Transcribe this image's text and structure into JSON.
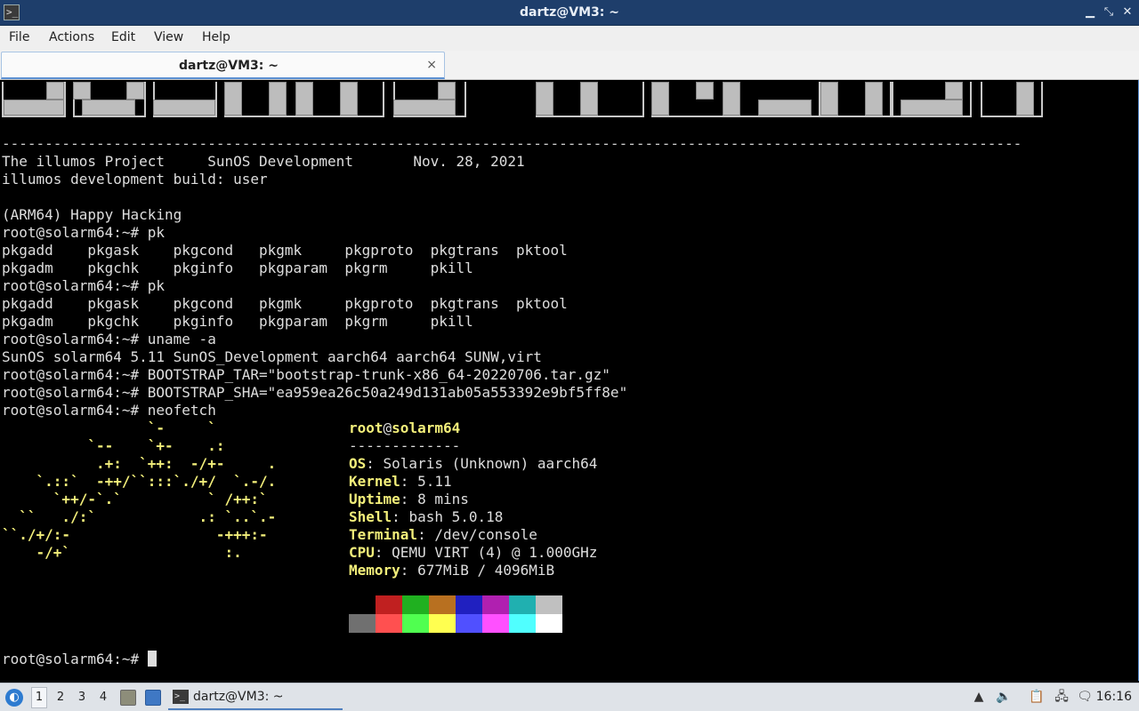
{
  "window": {
    "title": "dartz@VM3: ~"
  },
  "menu": [
    "File",
    "Actions",
    "Edit",
    "View",
    "Help"
  ],
  "tab": {
    "label": "dartz@VM3: ~",
    "close": "×"
  },
  "terminal": {
    "dash_line": "-----------------------------------------------------------------------------------------------------------------------",
    "lines": [
      "The illumos Project     SunOS Development       Nov. 28, 2021",
      "illumos development build: user",
      "",
      "(ARM64) Happy Hacking",
      "root@solarm64:~# pk",
      "pkgadd    pkgask    pkgcond   pkgmk     pkgproto  pkgtrans  pktool",
      "pkgadm    pkgchk    pkginfo   pkgparam  pkgrm     pkill",
      "root@solarm64:~# pk",
      "pkgadd    pkgask    pkgcond   pkgmk     pkgproto  pkgtrans  pktool",
      "pkgadm    pkgchk    pkginfo   pkgparam  pkgrm     pkill",
      "root@solarm64:~# uname -a",
      "SunOS solarm64 5.11 SunOS_Development aarch64 aarch64 SUNW,virt",
      "root@solarm64:~# BOOTSTRAP_TAR=\"bootstrap-trunk-x86_64-20220706.tar.gz\"",
      "root@solarm64:~# BOOTSTRAP_SHA=\"ea959ea26c50a249d131ab05a553392e9bf5ff8e\"",
      "root@solarm64:~# neofetch"
    ],
    "logo": [
      "                 `-     `",
      "          `--    `+-    .:",
      "           .+:  `++:  -/+-     .",
      "    `.::`  -++/``:::`./+/  `.-/.",
      "      `++/-`.`          ` /++:`",
      "  ``   ./:`            .: `..`.-",
      "``./+/:-                 -+++:-",
      "    -/+`                  :."
    ],
    "neofetch": {
      "user": "root",
      "at": "@",
      "host": "solarm64",
      "underline": "-------------",
      "fields": [
        {
          "key": "OS",
          "value": "Solaris (Unknown) aarch64"
        },
        {
          "key": "Kernel",
          "value": "5.11"
        },
        {
          "key": "Uptime",
          "value": "8 mins"
        },
        {
          "key": "Shell",
          "value": "bash 5.0.18"
        },
        {
          "key": "Terminal",
          "value": "/dev/console"
        },
        {
          "key": "CPU",
          "value": "QEMU VIRT (4) @ 1.000GHz"
        },
        {
          "key": "Memory",
          "value": "677MiB / 4096MiB"
        }
      ],
      "palette_top": [
        "#000000",
        "#c02020",
        "#20b020",
        "#b87020",
        "#2020c0",
        "#b020b0",
        "#20b0b0",
        "#c0c0c0"
      ],
      "palette_bottom": [
        "#707070",
        "#ff5050",
        "#50ff50",
        "#ffff50",
        "#5050ff",
        "#ff50ff",
        "#50ffff",
        "#ffffff"
      ]
    },
    "prompt": "root@solarm64:~# "
  },
  "taskbar": {
    "workspaces": [
      "1",
      "2",
      "3",
      "4"
    ],
    "window_label": "dartz@VM3: ~",
    "clock": "16:16"
  }
}
